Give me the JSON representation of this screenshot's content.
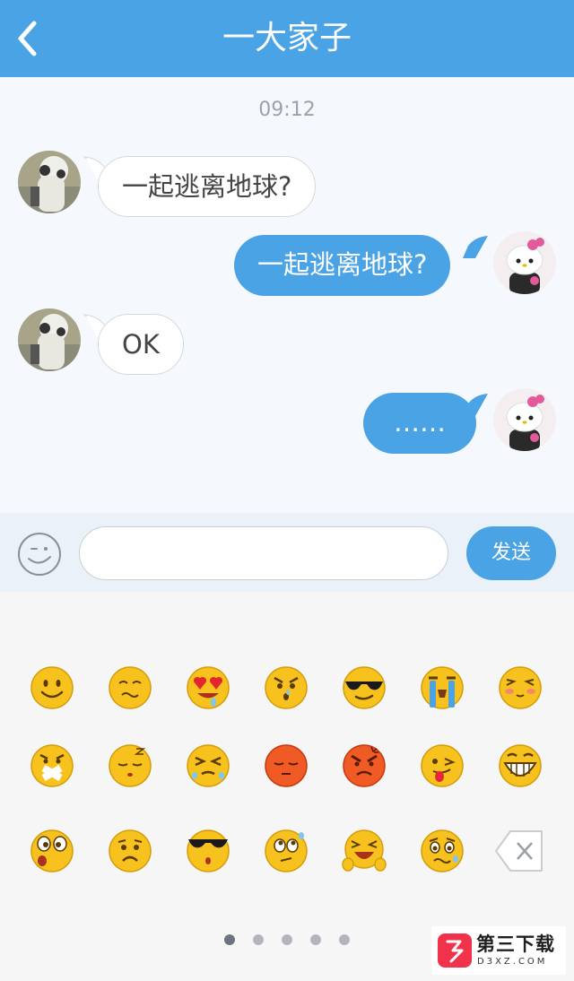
{
  "header": {
    "title": "一大家子",
    "back_icon": "chevron-left-icon"
  },
  "chat": {
    "timestamp": "09:12",
    "messages": [
      {
        "direction": "incoming",
        "text": "一起逃离地球?"
      },
      {
        "direction": "outgoing",
        "text": "一起逃离地球?"
      },
      {
        "direction": "incoming",
        "text": "OK"
      },
      {
        "direction": "outgoing",
        "text": "……"
      }
    ]
  },
  "input_bar": {
    "emoji_toggle_icon": "wink-smile-icon",
    "placeholder": "",
    "send_label": "发送"
  },
  "emoji_panel": {
    "emojis": [
      "smile",
      "embarrassed",
      "heart-eyes",
      "angry-sweat",
      "sunglasses",
      "crying",
      "shy-blush",
      "mouth-taped",
      "sleepy",
      "tearful-squint",
      "red-displeased",
      "red-angry",
      "tongue-wink",
      "grin",
      "surprised",
      "frown",
      "cool-shades",
      "thinking-sweat",
      "laugh-hands",
      "worried-sweat",
      "backspace"
    ],
    "page_count": 5,
    "active_page": 1
  },
  "watermark": {
    "title": "第三下载",
    "subtitle": "D3XZ.COM"
  },
  "colors": {
    "accent": "#4aa3e4",
    "background": "#f5f9fd",
    "emoji_panel": "#f6f6f6"
  }
}
